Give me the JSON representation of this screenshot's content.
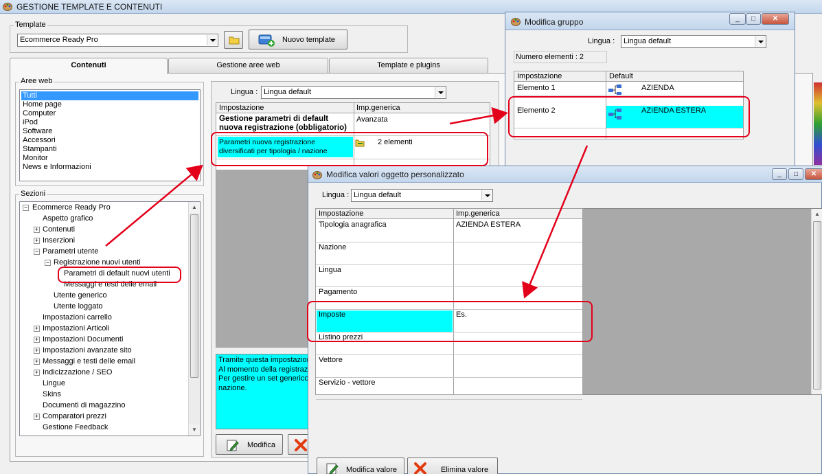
{
  "main_window": {
    "title": "GESTIONE TEMPLATE E CONTENUTI",
    "template_label": "Template",
    "template_value": "Ecommerce Ready Pro",
    "new_template_label": "Nuovo template",
    "tabs": [
      "Contenuti",
      "Gestione aree web",
      "Template e plugins"
    ],
    "aree_web_label": "Aree web",
    "aree_web": [
      "Tutti",
      "Home page",
      "Computer",
      "iPod",
      "Software",
      "Accessori",
      "Stampanti",
      "Monitor",
      "News e Informazioni"
    ],
    "sezioni_label": "Sezioni",
    "tree": [
      "Ecommerce Ready Pro",
      "Aspetto grafico",
      "Contenuti",
      "Inserzioni",
      "Parametri utente",
      "Registrazione nuovi utenti",
      "Parametri di default nuovi utenti",
      "Messaggi e testi delle email",
      "Utente generico",
      "Utente loggato",
      "Impostazioni carrello",
      "Impostazioni Articoli",
      "Impostazioni Documenti",
      "Impostazioni avanzate sito",
      "Messaggi e testi delle email",
      "Indicizzazione / SEO",
      "Lingue",
      "Skins",
      "Documenti di magazzino",
      "Comparatori prezzi",
      "Gestione Feedback"
    ],
    "lingua_label": "Lingua :",
    "lingua_value": "Lingua default",
    "grid_headers": [
      "Impostazione",
      "Imp.generica"
    ],
    "row1_name": "Gestione parametri di default nuova registrazione (obbligatorio)",
    "row1_value": "Avanzata",
    "row2_name": "Parametri nuova registrazione diversificati per tipologia / nazione",
    "row2_value": "2 elementi",
    "description": "Tramite questa impostazione\nAl momento della registrazio\nPer gestire un set generico\nnazione.",
    "modifica_label": "Modifica"
  },
  "gruppo_window": {
    "title": "Modifica gruppo",
    "lingua_label": "Lingua :",
    "lingua_value": "Lingua default",
    "count_label": "Numero elementi : 2",
    "headers": [
      "Impostazione",
      "Default"
    ],
    "rows": [
      {
        "name": "Elemento 1",
        "value": "AZIENDA"
      },
      {
        "name": "Elemento 2",
        "value": "AZIENDA ESTERA"
      }
    ]
  },
  "valori_window": {
    "title": "Modifica valori oggetto personalizzato",
    "lingua_label": "Lingua :",
    "lingua_value": "Lingua default",
    "headers": [
      "Impostazione",
      "Imp.generica"
    ],
    "rows": [
      {
        "name": "Tipologia anagrafica",
        "value": "AZIENDA ESTERA"
      },
      {
        "name": "Nazione",
        "value": ""
      },
      {
        "name": "Lingua",
        "value": ""
      },
      {
        "name": "Pagamento",
        "value": ""
      },
      {
        "name": "Imposte",
        "value": "Es."
      },
      {
        "name": "Listino prezzi",
        "value": ""
      },
      {
        "name": "Vettore",
        "value": ""
      },
      {
        "name": "Servizio - vettore",
        "value": ""
      }
    ],
    "modifica_valore_label": "Modifica valore",
    "elimina_valore_label": "Elimina valore"
  },
  "colors": {
    "highlight": "#00ffff",
    "selection": "#3399ff",
    "annotation": "#e3001a"
  }
}
